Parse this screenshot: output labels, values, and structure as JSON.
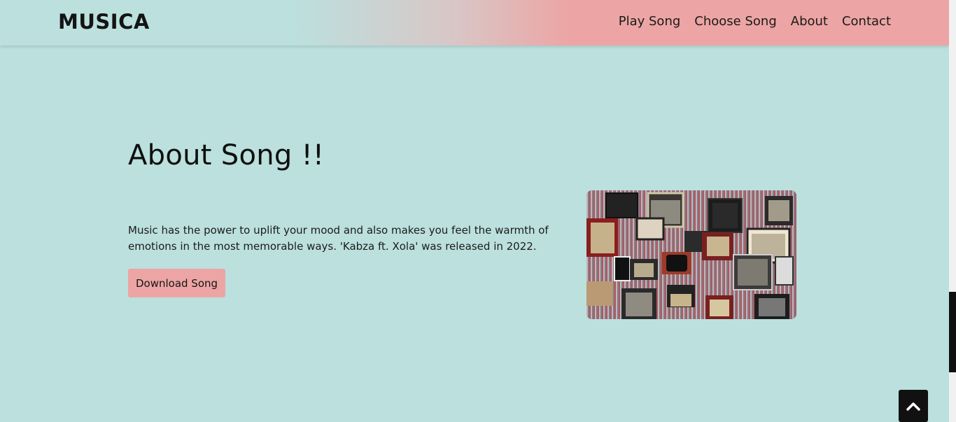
{
  "header": {
    "brand": "MUSICA",
    "nav": [
      {
        "label": "Play Song"
      },
      {
        "label": "Choose Song"
      },
      {
        "label": "About"
      },
      {
        "label": "Contact"
      }
    ]
  },
  "about": {
    "title": "About Song !!",
    "description": "Music has the power to uplift your mood and also makes you feel the warmth of emotions in the most memorable ways. 'Kabza ft. Xola' was released in 2022.",
    "download_label": "Download Song"
  },
  "icons": {
    "back_to_top": "chevron-up-icon"
  },
  "colors": {
    "background": "#bbe0de",
    "accent": "#eca5a4",
    "dark": "#111111"
  }
}
